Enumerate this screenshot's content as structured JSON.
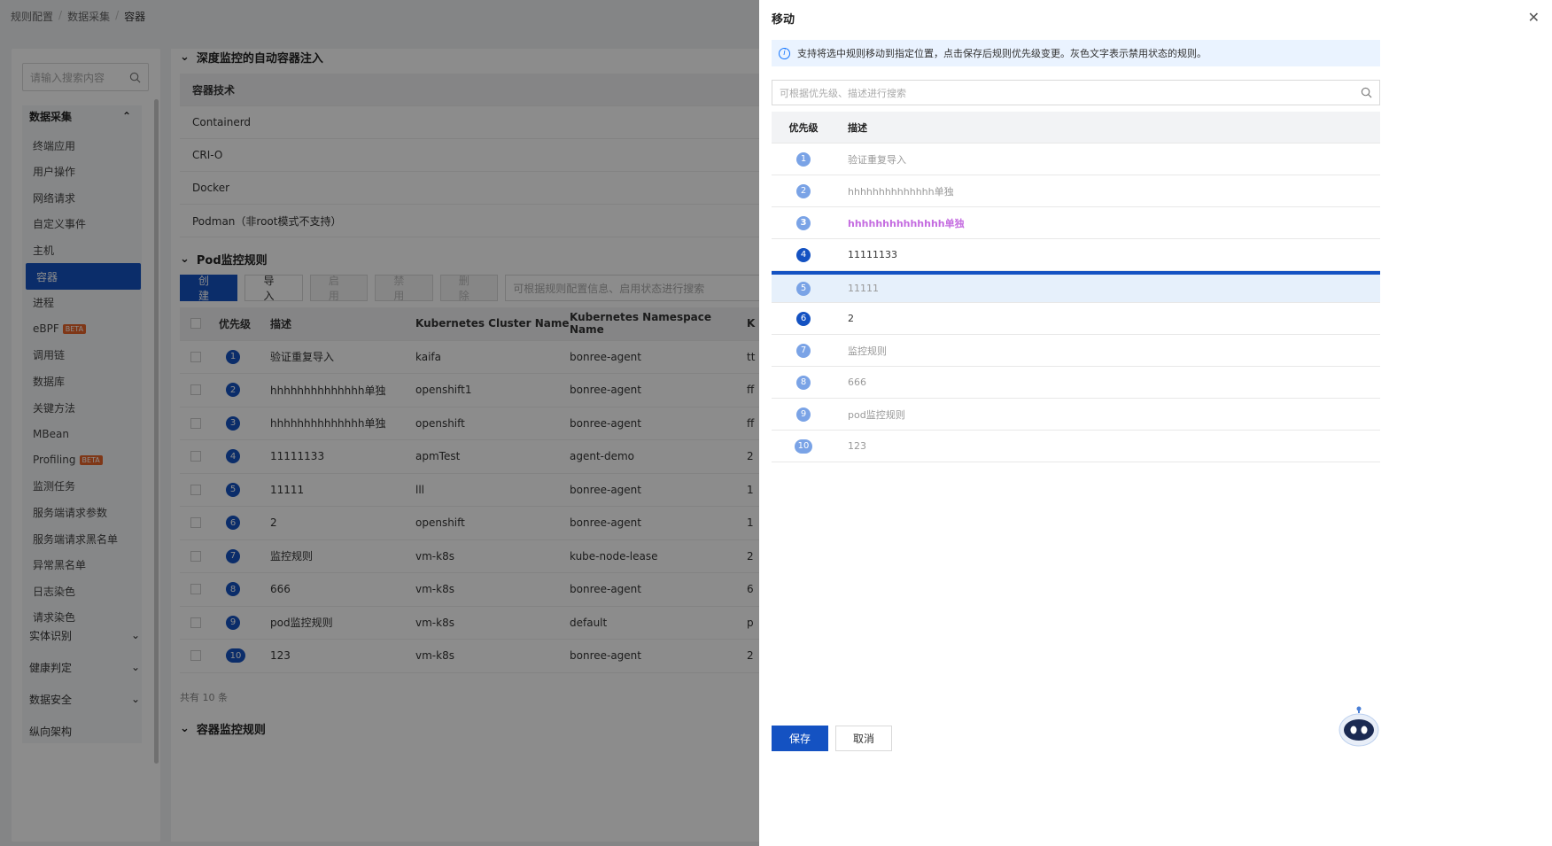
{
  "breadcrumb": [
    "规则配置",
    "数据采集",
    "容器"
  ],
  "sidebar": {
    "search_placeholder": "请输入搜索内容",
    "group_title": "数据采集",
    "items": [
      {
        "label": "终端应用"
      },
      {
        "label": "用户操作"
      },
      {
        "label": "网络请求"
      },
      {
        "label": "自定义事件"
      },
      {
        "label": "主机"
      },
      {
        "label": "容器",
        "active": true
      },
      {
        "label": "进程"
      },
      {
        "label": "eBPF",
        "badge": "BETA"
      },
      {
        "label": "调用链"
      },
      {
        "label": "数据库"
      },
      {
        "label": "关键方法"
      },
      {
        "label": "MBean"
      },
      {
        "label": "Profiling",
        "badge": "BETA"
      },
      {
        "label": "监测任务"
      },
      {
        "label": "服务端请求参数"
      },
      {
        "label": "服务端请求黑名单"
      },
      {
        "label": "异常黑名单"
      },
      {
        "label": "日志染色"
      },
      {
        "label": "请求染色"
      }
    ],
    "collapsed": [
      {
        "label": "实体识别"
      },
      {
        "label": "健康判定"
      },
      {
        "label": "数据安全"
      }
    ],
    "plain": [
      {
        "label": "纵向架构"
      }
    ]
  },
  "main": {
    "sec1_title": "深度监控的自动容器注入",
    "container_head": "容器技术",
    "containers": [
      "Containerd",
      "CRI-O",
      "Docker",
      "Podman（非root模式不支持）"
    ],
    "sec2_title": "Pod监控规则",
    "buttons": {
      "create": "创建",
      "import": "导入",
      "enable": "启用",
      "disable": "禁用",
      "delete": "删除"
    },
    "search_placeholder": "可根据规则配置信息、启用状态进行搜索",
    "columns": [
      "优先级",
      "描述",
      "Kubernetes Cluster Name",
      "Kubernetes Namespace Name",
      "K"
    ],
    "rows": [
      {
        "pri": "1",
        "desc": "验证重复导入",
        "cluster": "kaifa",
        "ns": "bonree-agent",
        "extra": "tt"
      },
      {
        "pri": "2",
        "desc": "hhhhhhhhhhhhhh单独",
        "cluster": "openshift1",
        "ns": "bonree-agent",
        "extra": "ff"
      },
      {
        "pri": "3",
        "desc": "hhhhhhhhhhhhhh单独",
        "cluster": "openshift",
        "ns": "bonree-agent",
        "extra": "ff"
      },
      {
        "pri": "4",
        "desc": "11111133",
        "cluster": "apmTest",
        "ns": "agent-demo",
        "extra": "2"
      },
      {
        "pri": "5",
        "desc": "11111",
        "cluster": "lll",
        "ns": "bonree-agent",
        "extra": "1"
      },
      {
        "pri": "6",
        "desc": "2",
        "cluster": "openshift",
        "ns": "bonree-agent",
        "extra": "1"
      },
      {
        "pri": "7",
        "desc": "监控规则",
        "cluster": "vm-k8s",
        "ns": "kube-node-lease",
        "extra": "2"
      },
      {
        "pri": "8",
        "desc": "666",
        "cluster": "vm-k8s",
        "ns": "bonree-agent",
        "extra": "6"
      },
      {
        "pri": "9",
        "desc": "pod监控规则",
        "cluster": "vm-k8s",
        "ns": "default",
        "extra": "p"
      },
      {
        "pri": "10",
        "desc": "123",
        "cluster": "vm-k8s",
        "ns": "bonree-agent",
        "extra": "2"
      }
    ],
    "total": "共有 10 条",
    "sec3_title": "容器监控规则"
  },
  "drawer": {
    "title": "移动",
    "info": "支持将选中规则移动到指定位置，点击保存后规则优先级变更。灰色文字表示禁用状态的规则。",
    "search_placeholder": "可根据优先级、描述进行搜索",
    "col_pri": "优先级",
    "col_desc": "描述",
    "rows": [
      {
        "pri": "1",
        "desc": "验证重复导入",
        "state": "disabled"
      },
      {
        "pri": "2",
        "desc": "hhhhhhhhhhhhhh单独",
        "state": "disabled"
      },
      {
        "pri": "3",
        "desc": "hhhhhhhhhhhhhh单独",
        "state": "highlight"
      },
      {
        "pri": "4",
        "desc": "11111133",
        "state": "enabled"
      },
      {
        "pri": "5",
        "desc": "11111",
        "state": "selected"
      },
      {
        "pri": "6",
        "desc": "2",
        "state": "enabled"
      },
      {
        "pri": "7",
        "desc": "监控规则",
        "state": "disabled"
      },
      {
        "pri": "8",
        "desc": "666",
        "state": "disabled"
      },
      {
        "pri": "9",
        "desc": "pod监控规则",
        "state": "disabled"
      },
      {
        "pri": "10",
        "desc": "123",
        "state": "disabled"
      }
    ],
    "save": "保存",
    "cancel": "取消"
  }
}
